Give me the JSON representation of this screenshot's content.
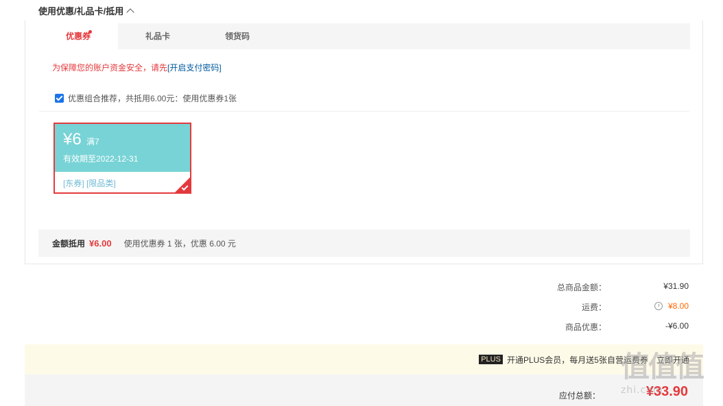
{
  "section": {
    "title": "使用优惠/礼品卡/抵用"
  },
  "tabs": [
    {
      "label": "优惠券",
      "active": true
    },
    {
      "label": "礼品卡",
      "active": false
    },
    {
      "label": "领货码",
      "active": false
    }
  ],
  "security": {
    "notice": "为保障您的账户资金安全，请先",
    "link_label": "[开启支付密码]"
  },
  "combo": {
    "checked": true,
    "text": "优惠组合推荐，共抵用6.00元：使用优惠券1张"
  },
  "coupon": {
    "amount": "¥6",
    "condition": "满7",
    "valid": "有效期至2022-12-31",
    "tags": "[东券]  [限品类]",
    "selected": true
  },
  "summary": {
    "label": "金额抵用",
    "amount": "¥6.00",
    "detail": "使用优惠券 1 张，优惠 6.00 元"
  },
  "totals": {
    "goods_label": "总商品金额：",
    "goods_value": "¥31.90",
    "shipping_label": "运费：",
    "shipping_value": "¥8.00",
    "discount_label": "商品优惠：",
    "discount_value": "-¥6.00"
  },
  "plus": {
    "badge": "PLUS",
    "text": "开通PLUS会员，每月送5张自营运费券",
    "link": "立即开通"
  },
  "pay": {
    "label": "应付总额：",
    "value": "¥33.90"
  },
  "watermark": {
    "logo": "值值值",
    "text": "zhi.com"
  },
  "colors": {
    "accent": "#e4393c",
    "coupon_bg": "#78d3d6",
    "orange": "#ff6600",
    "plus_bg": "#fefae8"
  }
}
